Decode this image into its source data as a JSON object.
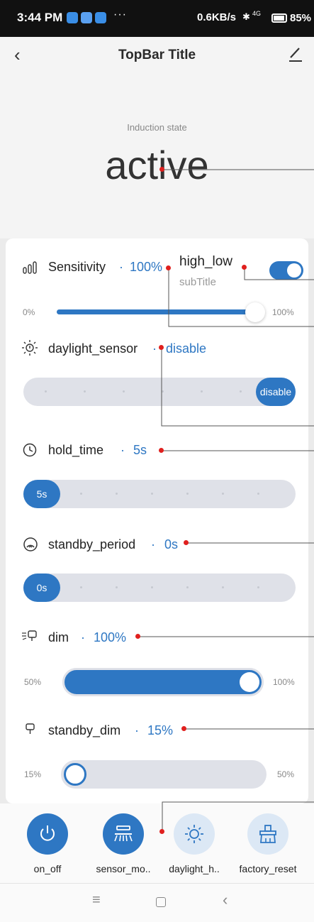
{
  "status_bar": {
    "time": "3:44 PM",
    "dots": "···",
    "net_speed": "0.6KB/s",
    "signal": "4G",
    "battery": "85%"
  },
  "top_bar": {
    "title": "TopBar Title"
  },
  "induction": {
    "label": "Induction state",
    "value": "active"
  },
  "sensitivity": {
    "label": "Sensitivity",
    "value": "100%",
    "min_label": "0%",
    "max_label": "100%",
    "level": 1.0,
    "switch_title": "high_low",
    "switch_subtitle": "subTitle",
    "switch_on": true
  },
  "daylight_sensor": {
    "label": "daylight_sensor",
    "value": "disable",
    "chip": "disable"
  },
  "hold_time": {
    "label": "hold_time",
    "value": "5s",
    "chip": "5s"
  },
  "standby_period": {
    "label": "standby_period",
    "value": "0s",
    "chip": "0s"
  },
  "dim": {
    "label": "dim",
    "value": "100%",
    "min_label": "50%",
    "max_label": "100%",
    "level": 1.0
  },
  "standby_dim": {
    "label": "standby_dim",
    "value": "15%",
    "min_label": "15%",
    "max_label": "50%",
    "level": 0.0
  },
  "separator": "·",
  "buttons": [
    {
      "label": "on_off",
      "icon": "power-icon",
      "active": true
    },
    {
      "label": "sensor_mo..",
      "icon": "sensor-lamp-icon",
      "active": true
    },
    {
      "label": "daylight_h..",
      "icon": "sun-icon",
      "active": false
    },
    {
      "label": "factory_reset",
      "icon": "reset-icon",
      "active": false
    }
  ],
  "colors": {
    "accent": "#2e77c3",
    "annotation": "#e0201e",
    "track": "#dfe1e8"
  }
}
